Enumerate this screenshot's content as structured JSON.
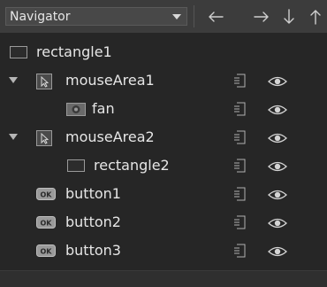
{
  "toolbar": {
    "view_select_value": "Navigator",
    "buttons": [
      {
        "name": "move-left-button",
        "icon": "arrow-left-icon"
      },
      {
        "name": "move-right-button",
        "icon": "arrow-right-icon"
      },
      {
        "name": "move-down-button",
        "icon": "arrow-down-icon"
      },
      {
        "name": "move-up-button",
        "icon": "arrow-up-icon"
      }
    ]
  },
  "tree": {
    "nodes": [
      {
        "label": "rectangle1",
        "icon": "rectangle-icon",
        "level": 0,
        "expandable": false,
        "alias_export": false,
        "visible_toggle": false
      },
      {
        "label": "mouseArea1",
        "icon": "cursor-icon",
        "level": 0,
        "expandable": true,
        "expanded": true,
        "alias_export": true,
        "visible_toggle": true
      },
      {
        "label": "fan",
        "icon": "image-icon",
        "level": 1,
        "expandable": false,
        "alias_export": true,
        "visible_toggle": true
      },
      {
        "label": "mouseArea2",
        "icon": "cursor-icon",
        "level": 0,
        "expandable": true,
        "expanded": true,
        "alias_export": true,
        "visible_toggle": true
      },
      {
        "label": "rectangle2",
        "icon": "rectangle-icon",
        "level": 1,
        "expandable": false,
        "alias_export": true,
        "visible_toggle": true
      },
      {
        "label": "button1",
        "icon": "ok-button-icon",
        "level": 0,
        "expandable": false,
        "alias_export": true,
        "visible_toggle": true
      },
      {
        "label": "button2",
        "icon": "ok-button-icon",
        "level": 0,
        "expandable": false,
        "alias_export": true,
        "visible_toggle": true
      },
      {
        "label": "button3",
        "icon": "ok-button-icon",
        "level": 0,
        "expandable": false,
        "alias_export": true,
        "visible_toggle": true
      }
    ]
  },
  "colors": {
    "background": "#262626",
    "toolbar": "#3c3c3c",
    "text": "#e6e6e6",
    "icon_gray": "#8a8a8a"
  }
}
